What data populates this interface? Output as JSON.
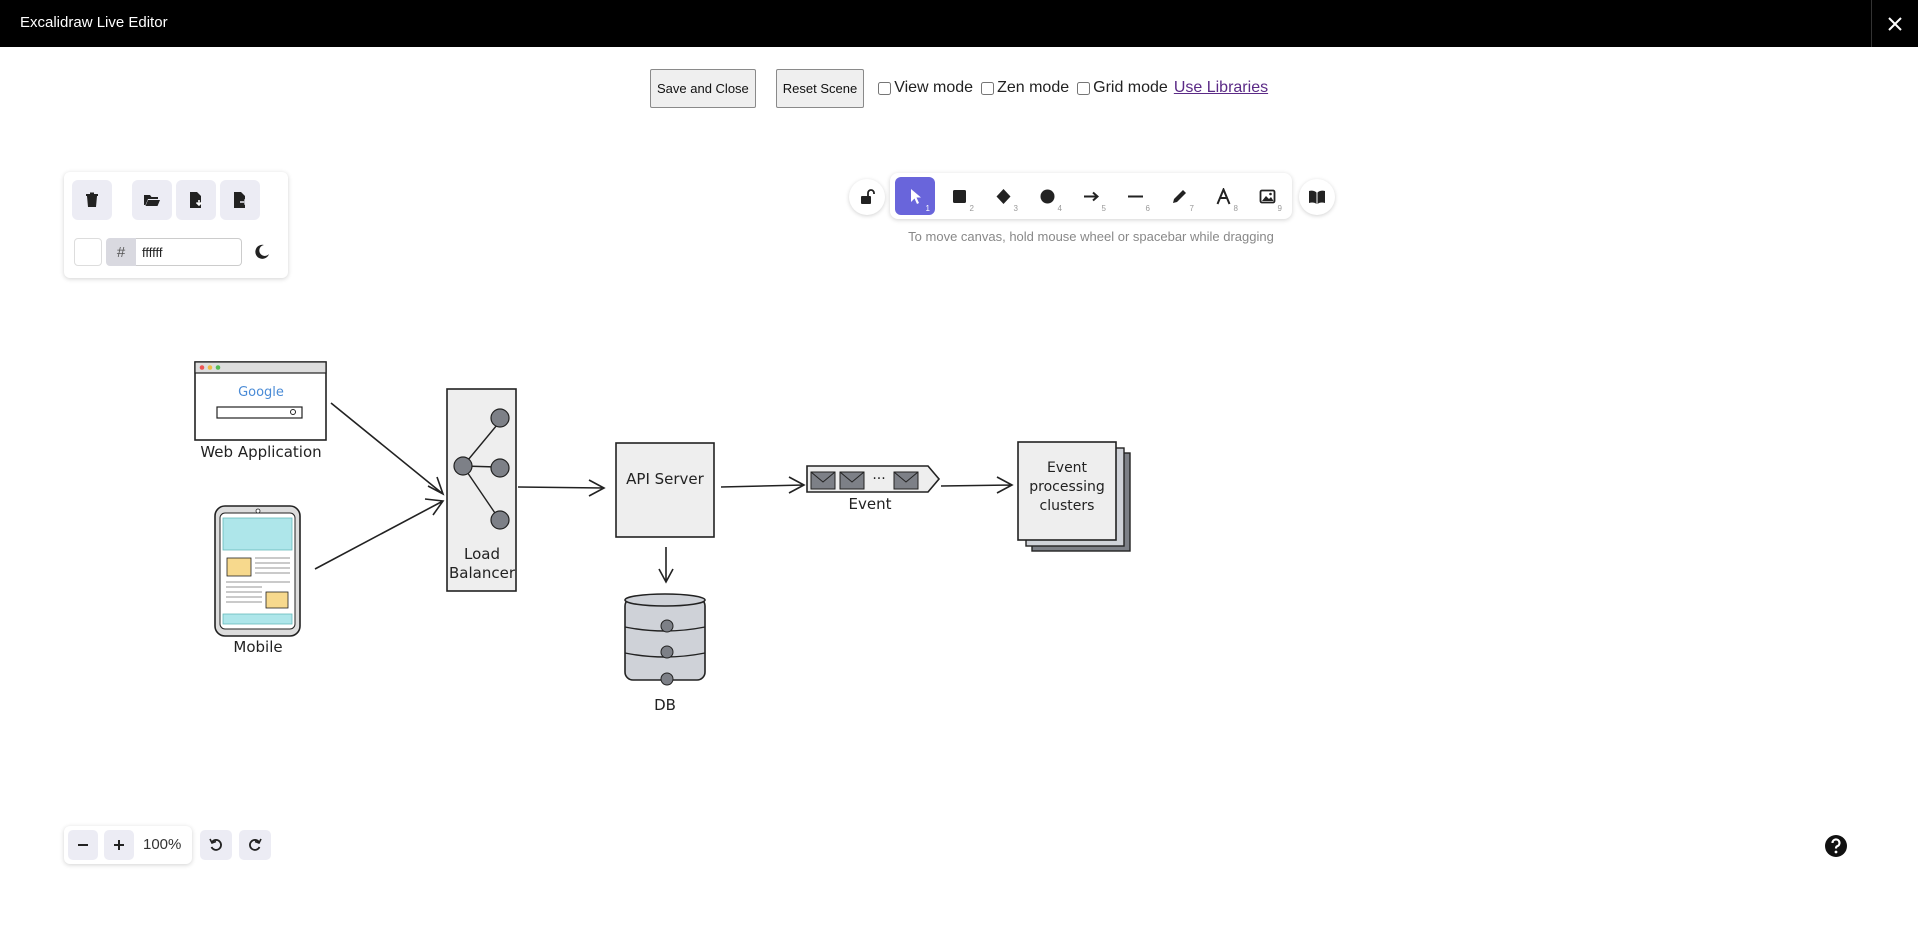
{
  "window": {
    "title": "Excalidraw Live Editor"
  },
  "controls": {
    "save_label": "Save and Close",
    "reset_label": "Reset Scene",
    "view_mode_label": "View mode",
    "zen_mode_label": "Zen mode",
    "grid_mode_label": "Grid mode",
    "libraries_link": "Use Libraries"
  },
  "canvas_menu": {
    "hash": "#",
    "background_hex": "ffffff"
  },
  "tools": [
    {
      "name": "selection",
      "num": "1",
      "active": true
    },
    {
      "name": "rectangle",
      "num": "2"
    },
    {
      "name": "diamond",
      "num": "3"
    },
    {
      "name": "ellipse",
      "num": "4"
    },
    {
      "name": "arrow",
      "num": "5"
    },
    {
      "name": "line",
      "num": "6"
    },
    {
      "name": "draw",
      "num": "7"
    },
    {
      "name": "text",
      "num": "8"
    },
    {
      "name": "image",
      "num": "9"
    }
  ],
  "hint": "To move canvas, hold mouse wheel or spacebar while dragging",
  "diagram": {
    "web_app": "Web Application",
    "google": "Google",
    "mobile": "Mobile",
    "load_balancer_1": "Load",
    "load_balancer_2": "Balancer",
    "api_server": "API Server",
    "db": "DB",
    "event": "Event",
    "event_dots": "...",
    "clusters_1": "Event",
    "clusters_2": "processing",
    "clusters_3": "clusters"
  },
  "zoom": {
    "level": "100%"
  },
  "colors": {
    "accent": "#6965db",
    "titlebar": "#000000",
    "panel_btn": "#ececf4"
  }
}
